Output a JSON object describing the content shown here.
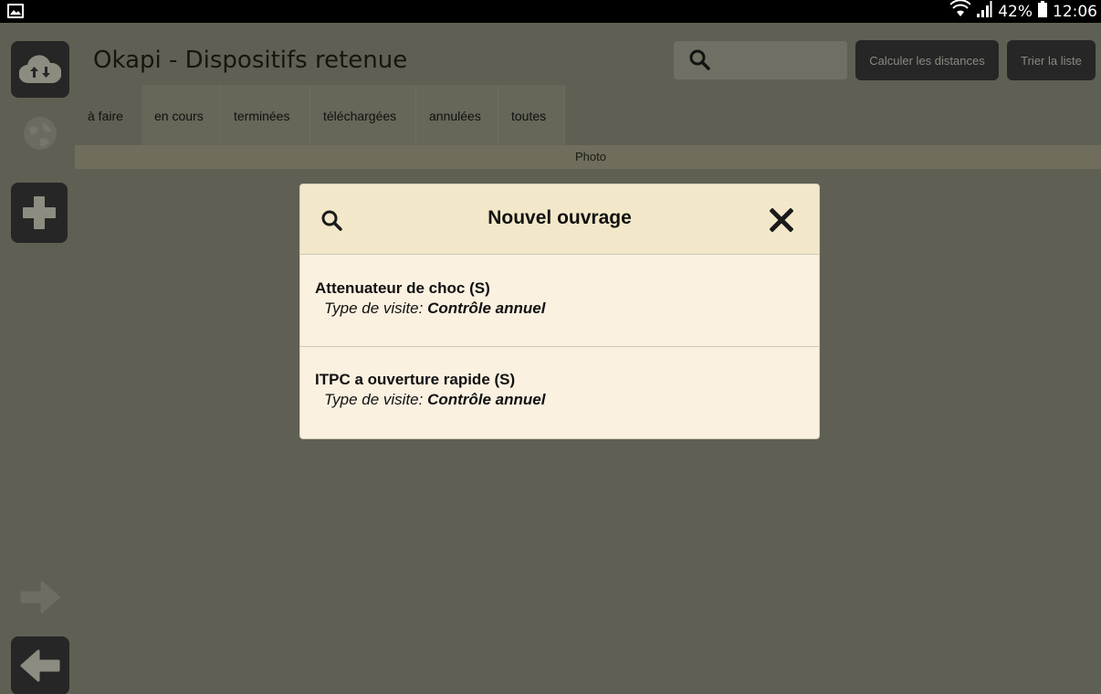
{
  "status_bar": {
    "battery": "42%",
    "time": "12:06"
  },
  "app": {
    "title": "Okapi - Dispositifs retenue",
    "search_placeholder": "",
    "calc_button": "Calculer les distances",
    "sort_button": "Trier la liste"
  },
  "tabs": [
    {
      "label": "à faire"
    },
    {
      "label": "en cours"
    },
    {
      "label": "terminées"
    },
    {
      "label": "téléchargées"
    },
    {
      "label": "annulées"
    },
    {
      "label": "toutes"
    }
  ],
  "column_header": "Photo",
  "dialog": {
    "title": "Nouvel ouvrage",
    "items": [
      {
        "name": "Attenuateur de choc (S)",
        "visit_label": "Type de visite:",
        "visit_value": "Contrôle annuel"
      },
      {
        "name": "ITPC a ouverture rapide (S)",
        "visit_label": "Type de visite:",
        "visit_value": "Contrôle annuel"
      }
    ]
  },
  "icons": {
    "sync": "cloud-sync-icon",
    "globe": "globe-icon",
    "add": "plus-icon",
    "next": "arrow-right-icon",
    "back": "arrow-left-icon",
    "search": "search-icon",
    "close": "close-icon"
  }
}
